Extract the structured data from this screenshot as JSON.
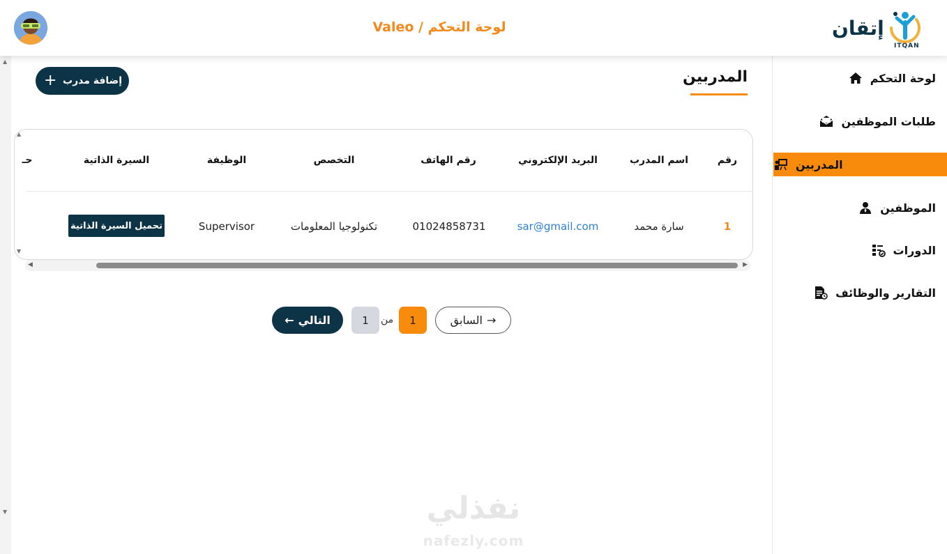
{
  "header": {
    "title": "لوحة التحكم / Valeo",
    "brand_name": "إتقان",
    "brand_tagline": "ITQAN"
  },
  "sidebar": {
    "items": [
      {
        "label": "لوحة التحكم",
        "icon": "home-icon",
        "active": false
      },
      {
        "label": "طلبات الموظفين",
        "icon": "envelope-open-icon",
        "active": false
      },
      {
        "label": "المدربين",
        "icon": "trainer-board-icon",
        "active": true
      },
      {
        "label": "الموظفين",
        "icon": "user-tie-icon",
        "active": false
      },
      {
        "label": "الدورات",
        "icon": "courses-checklist-icon",
        "active": false
      },
      {
        "label": "التقارير والوظائف",
        "icon": "report-file-icon",
        "active": false
      }
    ]
  },
  "main": {
    "title": "المدربين",
    "add_button_label": "إضافة مدرب"
  },
  "table": {
    "columns": [
      "رقم",
      "اسم المدرب",
      "البريد الإلكتروني",
      "رقم الهاتف",
      "التخصص",
      "الوظيفة",
      "السيرة الذاتية",
      "حـ"
    ],
    "rows": [
      {
        "id": "1",
        "name": "سارة محمد",
        "email": "sar@gmail.com",
        "phone": "01024858731",
        "specialty": "تكنولوجيا المعلومات",
        "job": "Supervisor",
        "cv_button": "تحميل السيرة الذاتية"
      }
    ]
  },
  "pagination": {
    "prev_label": "السابق",
    "current_page": "1",
    "of_label": "من",
    "total_pages": "1",
    "next_label": "التالي"
  },
  "watermark": {
    "arabic": "نفذلي",
    "latin": "nafezly.com"
  },
  "colors": {
    "accent": "#f98b0c",
    "navy": "#0d3347",
    "link": "#2d7fd3"
  }
}
